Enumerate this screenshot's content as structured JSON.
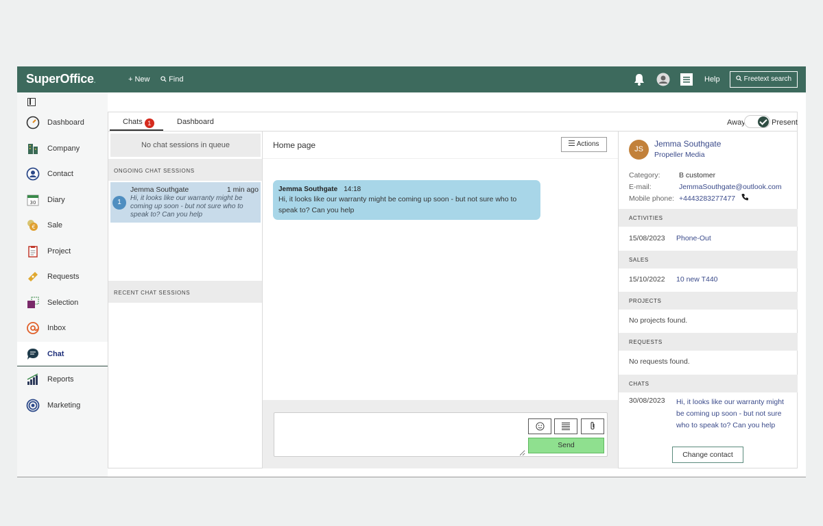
{
  "topbar": {
    "logo": "SuperOffice",
    "logo_dot": ".",
    "new_label": "+ New",
    "find_label": "Find",
    "help_label": "Help",
    "freetext_label": "Freetext search"
  },
  "sidebar": {
    "items": [
      {
        "label": "Dashboard",
        "icon": "dashboard-icon"
      },
      {
        "label": "Company",
        "icon": "company-icon"
      },
      {
        "label": "Contact",
        "icon": "contact-icon"
      },
      {
        "label": "Diary",
        "icon": "diary-icon"
      },
      {
        "label": "Sale",
        "icon": "sale-icon"
      },
      {
        "label": "Project",
        "icon": "project-icon"
      },
      {
        "label": "Requests",
        "icon": "requests-icon"
      },
      {
        "label": "Selection",
        "icon": "selection-icon"
      },
      {
        "label": "Inbox",
        "icon": "inbox-icon"
      },
      {
        "label": "Chat",
        "icon": "chat-icon",
        "active": true
      },
      {
        "label": "Reports",
        "icon": "reports-icon"
      },
      {
        "label": "Marketing",
        "icon": "marketing-icon"
      }
    ],
    "diary_day": "30"
  },
  "tabs": {
    "chats_label": "Chats",
    "chats_badge": "1",
    "dashboard_label": "Dashboard"
  },
  "status": {
    "away_label": "Away",
    "present_label": "Present"
  },
  "chat_list": {
    "queue_text": "No chat sessions in queue",
    "ongoing_header": "ONGOING CHAT SESSIONS",
    "recent_header": "RECENT CHAT SESSIONS",
    "sessions": [
      {
        "number": "1",
        "name": "Jemma Southgate",
        "time": "1 min ago",
        "preview": "Hi, it looks like our warranty might be coming up soon - but not sure who to speak to? Can you help"
      }
    ]
  },
  "conversation": {
    "title": "Home page",
    "actions_label": "Actions",
    "messages": [
      {
        "author": "Jemma Southgate",
        "time": "14:18",
        "text": "Hi, it looks like our warranty might be coming up soon - but not sure who to speak to? Can you help"
      }
    ],
    "compose_placeholder": "",
    "send_label": "Send"
  },
  "contact": {
    "initials": "JS",
    "name": "Jemma Southgate",
    "company": "Propeller Media",
    "category_label": "Category:",
    "category_value": "B customer",
    "email_label": "E-mail:",
    "email_value": "JemmaSouthgate@outlook.com",
    "mobile_label": "Mobile phone:",
    "mobile_value": "+4443283277477",
    "activities_header": "ACTIVITIES",
    "activity_date": "15/08/2023",
    "activity_text": "Phone-Out",
    "sales_header": "SALES",
    "sale_date": "15/10/2022",
    "sale_text": "10 new T440",
    "projects_header": "PROJECTS",
    "projects_empty": "No projects found.",
    "requests_header": "REQUESTS",
    "requests_empty": "No requests found.",
    "chats_header": "CHATS",
    "chat_date": "30/08/2023",
    "chat_text": "Hi, it looks like our warranty might be coming up soon - but not sure who to speak to? Can you help",
    "change_label": "Change contact"
  },
  "colors": {
    "topbar": "#3d6a5d",
    "accent_link": "#3a4a8a",
    "bubble": "#a8d6e8",
    "send": "#8fe08f",
    "badge": "#d52b1e"
  }
}
